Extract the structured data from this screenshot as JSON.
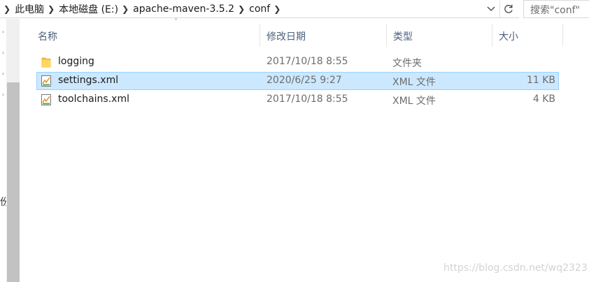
{
  "address_bar": {
    "crumbs": [
      "此电脑",
      "本地磁盘 (E:)",
      "apache-maven-3.5.2",
      "conf"
    ],
    "search_placeholder": "搜索\"conf\""
  },
  "nav_pane": {
    "label_fragment": "份"
  },
  "columns": {
    "name": "名称",
    "date": "修改日期",
    "type": "类型",
    "size": "大小"
  },
  "files": [
    {
      "name": "logging",
      "date": "2017/10/18 8:55",
      "type": "文件夹",
      "size": "",
      "icon": "folder-icon",
      "selected": false
    },
    {
      "name": "settings.xml",
      "date": "2020/6/25 9:27",
      "type": "XML 文件",
      "size": "11 KB",
      "icon": "xml-file-icon",
      "selected": true
    },
    {
      "name": "toolchains.xml",
      "date": "2017/10/18 8:55",
      "type": "XML 文件",
      "size": "4 KB",
      "icon": "xml-file-icon",
      "selected": false
    }
  ],
  "watermark": "https://blog.csdn.net/wq2323",
  "colors": {
    "selection_fill": "#cce8ff",
    "selection_border": "#99d1ff",
    "header_text": "#4c607a",
    "folder": "#f5c542"
  }
}
